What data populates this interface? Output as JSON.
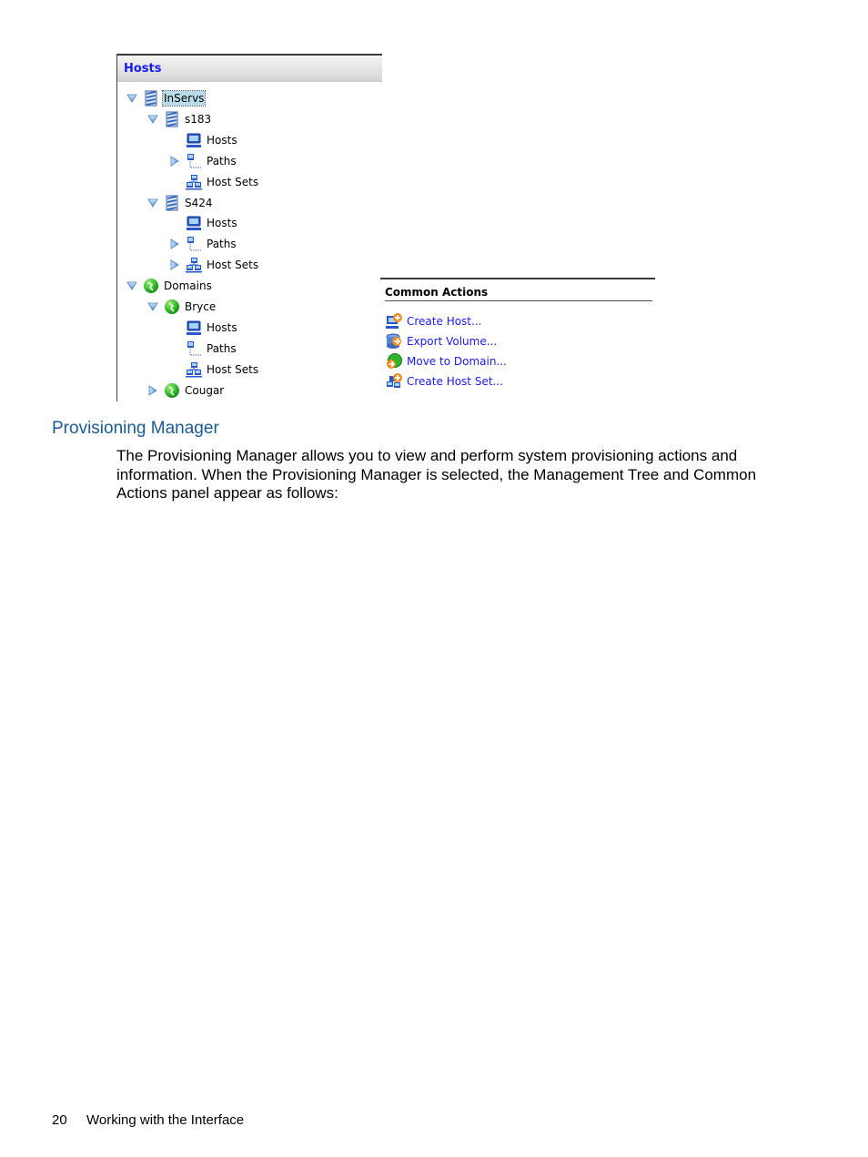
{
  "tree_panel": {
    "header": "Hosts",
    "items": [
      {
        "label": "InServs",
        "icon": "storage-server-icon",
        "toggle": "expanded",
        "level": 0,
        "selected": true
      },
      {
        "label": "s183",
        "icon": "storage-server-icon",
        "toggle": "expanded",
        "level": 1
      },
      {
        "label": "Hosts",
        "icon": "host-computer-icon",
        "toggle": "none",
        "level": 2
      },
      {
        "label": "Paths",
        "icon": "paths-icon",
        "toggle": "collapsed",
        "level": 2
      },
      {
        "label": "Host Sets",
        "icon": "host-sets-icon",
        "toggle": "none",
        "level": 2
      },
      {
        "label": "S424",
        "icon": "storage-server-icon",
        "toggle": "expanded",
        "level": 1
      },
      {
        "label": "Hosts",
        "icon": "host-computer-icon",
        "toggle": "none",
        "level": 2
      },
      {
        "label": "Paths",
        "icon": "paths-icon",
        "toggle": "collapsed",
        "level": 2
      },
      {
        "label": "Host Sets",
        "icon": "host-sets-icon",
        "toggle": "collapsed",
        "level": 2
      },
      {
        "label": "Domains",
        "icon": "domain-globe-icon",
        "toggle": "expanded",
        "level": 0
      },
      {
        "label": "Bryce",
        "icon": "domain-globe-icon",
        "toggle": "expanded",
        "level": 1
      },
      {
        "label": "Hosts",
        "icon": "host-computer-icon",
        "toggle": "none",
        "level": 2
      },
      {
        "label": "Paths",
        "icon": "paths-icon",
        "toggle": "none",
        "level": 2
      },
      {
        "label": "Host Sets",
        "icon": "host-sets-icon",
        "toggle": "none",
        "level": 2
      },
      {
        "label": "Cougar",
        "icon": "domain-globe-icon",
        "toggle": "collapsed",
        "level": 1
      }
    ]
  },
  "common_actions": {
    "title": "Common Actions",
    "items": [
      {
        "label": "Create Host...",
        "icon": "create-host-icon"
      },
      {
        "label": "Export Volume...",
        "icon": "export-volume-icon"
      },
      {
        "label": "Move to Domain...",
        "icon": "move-to-domain-icon"
      },
      {
        "label": "Create Host Set...",
        "icon": "create-host-set-icon"
      }
    ]
  },
  "document": {
    "section_heading": "Provisioning Manager",
    "body": "The Provisioning Manager allows you to view and perform system provisioning actions and information. When the Provisioning Manager is selected, the Management Tree and Common Actions panel appear as follows:"
  },
  "footer": {
    "page_number": "20",
    "chapter": "Working with the Interface"
  },
  "colors": {
    "link_blue": "#1a1aee",
    "heading_blue": "#1b5a96",
    "selection_bg": "#b9dcea"
  }
}
